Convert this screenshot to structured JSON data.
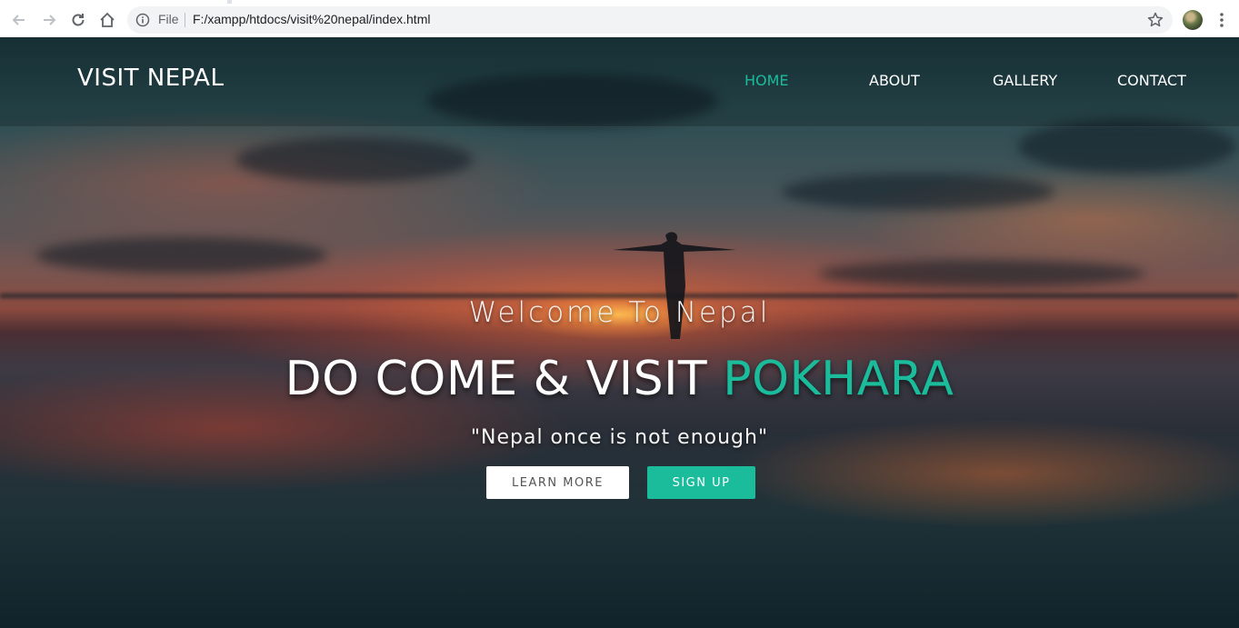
{
  "browser": {
    "file_label": "File",
    "url": "F:/xampp/htdocs/visit%20nepal/index.html",
    "icons": [
      "back-arrow-icon",
      "forward-arrow-icon",
      "reload-icon",
      "home-icon",
      "info-icon",
      "star-icon",
      "profile-avatar",
      "menu-dots-icon"
    ]
  },
  "site": {
    "brand": "VISIT NEPAL",
    "nav": [
      {
        "label": "HOME",
        "active": true
      },
      {
        "label": "ABOUT",
        "active": false
      },
      {
        "label": "GALLERY",
        "active": false
      },
      {
        "label": "CONTACT",
        "active": false
      }
    ]
  },
  "hero": {
    "welcome": "Welcome To Nepal",
    "headline_main": "DO COME & VISIT",
    "headline_accent": "POKHARA",
    "tagline": "\"Nepal once is not enough\"",
    "buttons": {
      "learn_more": "LEARN MORE",
      "sign_up": "SIGN UP"
    }
  },
  "colors": {
    "accent": "#1abc9c",
    "text_light": "#ffffff",
    "button_light": "#ffffff"
  }
}
